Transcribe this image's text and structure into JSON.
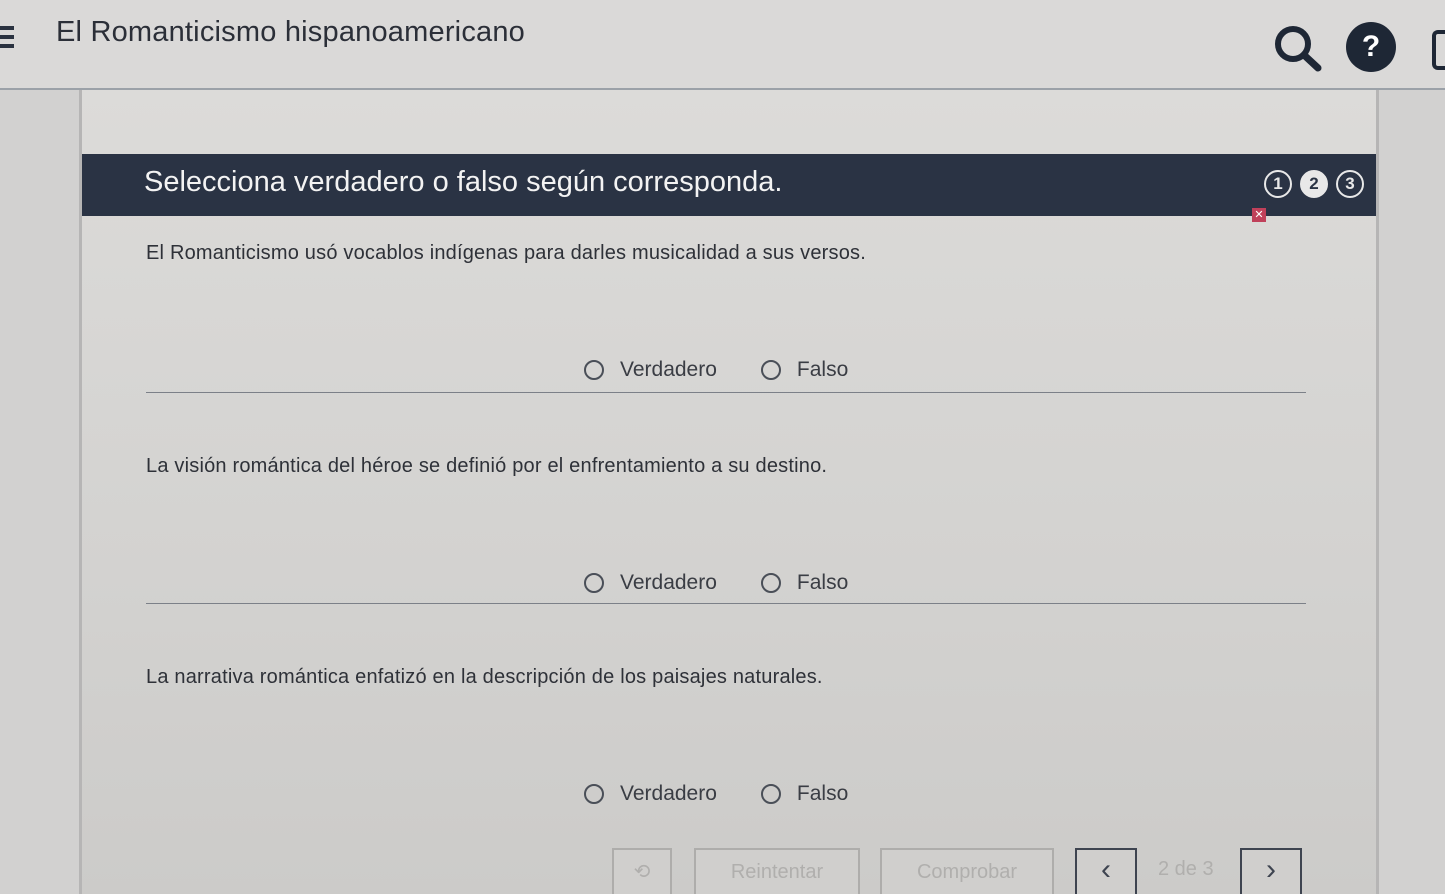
{
  "header": {
    "title": "El Romanticismo hispanoamericano",
    "menu_icon": "hamburger-menu-icon",
    "search_icon": "search-icon",
    "help_label": "?"
  },
  "instruction": {
    "text": "Selecciona verdadero o falso según corresponda.",
    "steps": [
      "1",
      "2",
      "3"
    ],
    "current_step": "2",
    "error_marker": "✕"
  },
  "questions": [
    {
      "text": "El Romanticismo usó vocablos indígenas para darles musicalidad a sus versos.",
      "options": [
        "Verdadero",
        "Falso"
      ]
    },
    {
      "text": "La visión romántica del héroe se definió por el enfrentamiento a su destino.",
      "options": [
        "Verdadero",
        "Falso"
      ]
    },
    {
      "text": "La narrativa romántica enfatizó en la descripción de los paisajes naturales.",
      "options": [
        "Verdadero",
        "Falso"
      ]
    }
  ],
  "controls": {
    "undo_label": "⟲",
    "retry_label": "Reintentar",
    "check_label": "Comprobar",
    "prev_label": "‹",
    "page_indicator": "2 de 3",
    "next_label": "›"
  },
  "colors": {
    "instruction_bar": "#2a3344",
    "text": "#2e3138",
    "disabled": "#b0afad"
  }
}
